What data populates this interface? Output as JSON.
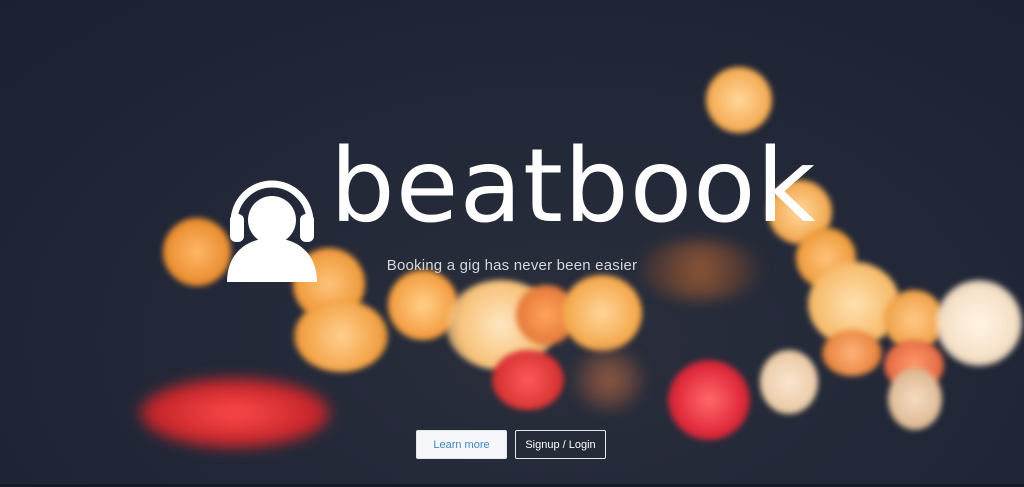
{
  "brand": {
    "name": "beatbook",
    "tagline": "Booking a gig has never been easier",
    "logo_icon": "headphones-person-icon"
  },
  "actions": {
    "learn_more_label": "Learn more",
    "signup_login_label": "Signup / Login"
  },
  "colors": {
    "background": "#1f2637",
    "text": "#ffffff",
    "tagline": "#d4d6dc",
    "learn_more_text": "#3f86c2",
    "learn_more_bg": "#f5f7fa"
  }
}
